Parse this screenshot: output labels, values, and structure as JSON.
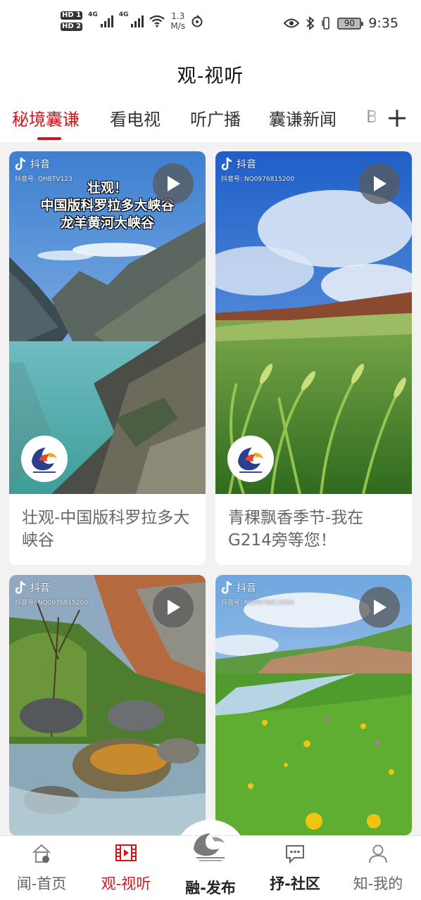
{
  "status_bar": {
    "hd1": "HD 1",
    "hd2": "HD 2",
    "net_type_1": "4G",
    "net_type_2": "4G",
    "speed_value": "1.3",
    "speed_unit": "M/s",
    "battery": "90",
    "time": "9:35"
  },
  "header": {
    "title": "观-视听"
  },
  "tabs": [
    {
      "label": "秘境囊谦",
      "active": true
    },
    {
      "label": "看电视",
      "active": false
    },
    {
      "label": "听广播",
      "active": false
    },
    {
      "label": "囊谦新闻",
      "active": false
    },
    {
      "label": "B",
      "active": false
    }
  ],
  "videos": [
    {
      "title": "壮观-中国版科罗拉多大峡谷",
      "platform": "抖音",
      "account": "抖音号: QHBTV123",
      "overlay_lines": [
        "壮观！",
        "中国版科罗拉多大峡谷",
        "龙羊黄河大峡谷"
      ]
    },
    {
      "title": "青稞飘香季节-我在G214旁等您！",
      "platform": "抖音",
      "account": "抖音号: NQ0976815200"
    },
    {
      "title": "",
      "platform": "抖音",
      "account": "抖音号: NQ0976815200"
    },
    {
      "title": "",
      "platform": "抖音",
      "account": "抖音号: NQ0976815200"
    }
  ],
  "bottom_nav": [
    {
      "label": "闻-首页",
      "icon": "home-icon",
      "active": false
    },
    {
      "label": "观-视听",
      "icon": "film-icon",
      "active": true
    },
    {
      "label": "融-发布",
      "icon": "brand-logo-icon",
      "active": false
    },
    {
      "label": "抒-社区",
      "icon": "chat-icon",
      "active": false
    },
    {
      "label": "知-我的",
      "icon": "person-icon",
      "active": false
    }
  ],
  "colors": {
    "accent": "#d0161c"
  }
}
